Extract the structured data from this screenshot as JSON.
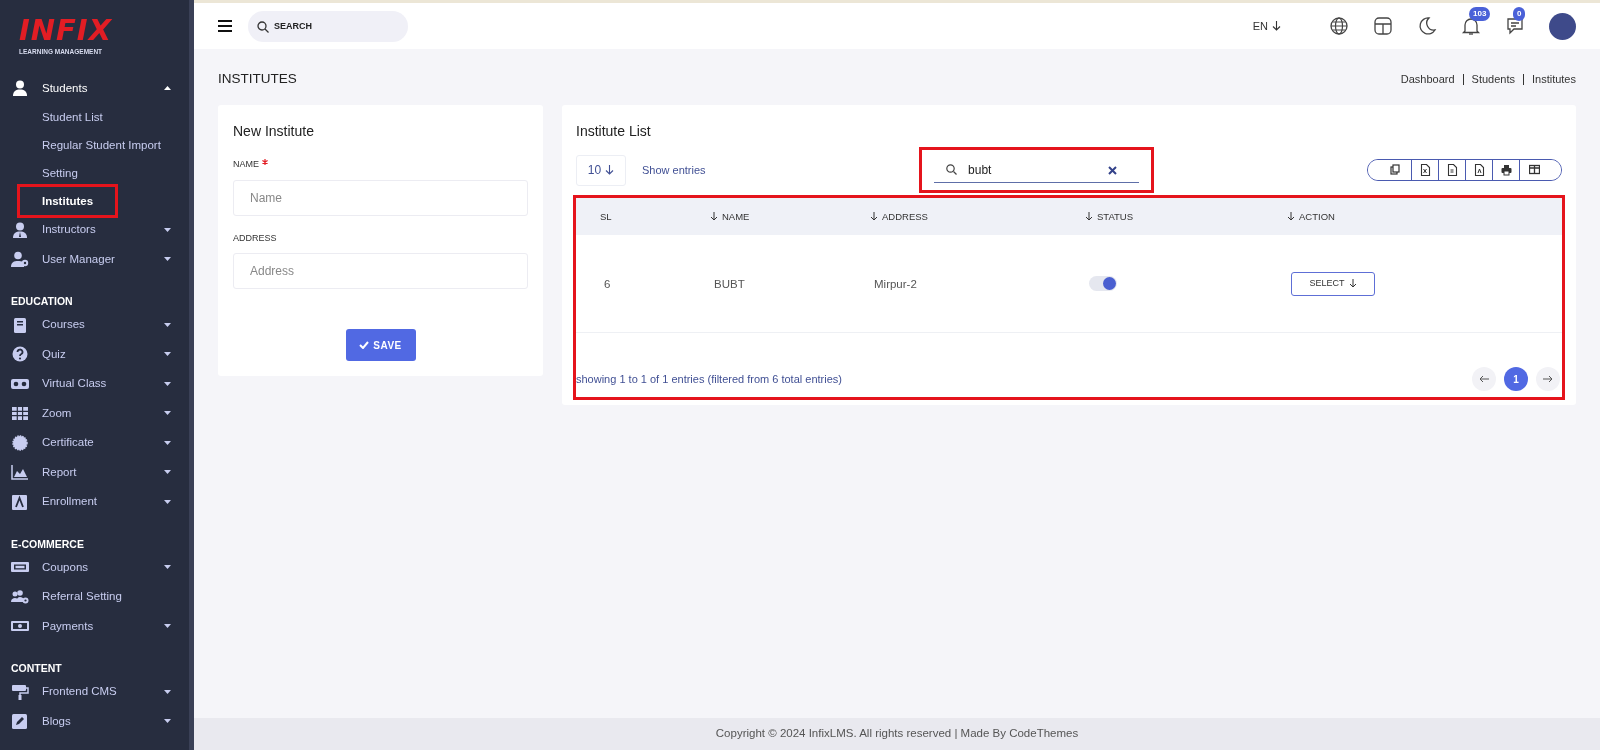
{
  "logo": {
    "title": "INFIX",
    "subtitle": "LEARNING MANAGEMENT"
  },
  "sidebar": {
    "sections": [
      {
        "items": [
          {
            "label": "Students",
            "expandable": true,
            "expanded": true,
            "children": [
              {
                "label": "Student List",
                "selected": false,
                "highlighted": false
              },
              {
                "label": "Regular Student Import",
                "selected": false,
                "highlighted": false
              },
              {
                "label": "Setting",
                "selected": false,
                "highlighted": false
              },
              {
                "label": "Institutes",
                "selected": true,
                "highlighted": true
              }
            ]
          },
          {
            "label": "Instructors",
            "expandable": true,
            "expanded": false
          },
          {
            "label": "User Manager",
            "expandable": true,
            "expanded": false
          }
        ]
      },
      {
        "heading": "EDUCATION",
        "items": [
          {
            "label": "Courses",
            "expandable": true,
            "expanded": false
          },
          {
            "label": "Quiz",
            "expandable": true,
            "expanded": false
          },
          {
            "label": "Virtual Class",
            "expandable": true,
            "expanded": false
          },
          {
            "label": "Zoom",
            "expandable": true,
            "expanded": false
          },
          {
            "label": "Certificate",
            "expandable": true,
            "expanded": false
          },
          {
            "label": "Report",
            "expandable": true,
            "expanded": false
          },
          {
            "label": "Enrollment",
            "expandable": true,
            "expanded": false
          }
        ]
      },
      {
        "heading": "E-COMMERCE",
        "items": [
          {
            "label": "Coupons",
            "expandable": true,
            "expanded": false
          },
          {
            "label": "Referral Setting",
            "expandable": false,
            "expanded": false
          },
          {
            "label": "Payments",
            "expandable": true,
            "expanded": false
          }
        ]
      },
      {
        "heading": "CONTENT",
        "items": [
          {
            "label": "Frontend CMS",
            "expandable": true,
            "expanded": false
          },
          {
            "label": "Blogs",
            "expandable": true,
            "expanded": false
          }
        ]
      }
    ]
  },
  "topbar": {
    "search": {
      "placeholder": "SEARCH"
    },
    "language": "EN",
    "notifications": "103",
    "messages": "0"
  },
  "page": {
    "title": "INSTITUTES",
    "breadcrumb": [
      "Dashboard",
      "Students",
      "Institutes"
    ]
  },
  "form": {
    "title": "New Institute",
    "fields": [
      {
        "label": "NAME",
        "required": true,
        "placeholder": "Name"
      },
      {
        "label": "ADDRESS",
        "placeholder": "Address"
      }
    ],
    "save": "SAVE"
  },
  "list": {
    "title": "Institute List",
    "page_size": "10",
    "show_entries": "Show entries",
    "search": {
      "value": "bubt",
      "highlighted": true
    },
    "highlighted": true,
    "columns": [
      {
        "label": "SL",
        "sortable": false
      },
      {
        "label": "NAME",
        "sortable": true
      },
      {
        "label": "ADDRESS",
        "sortable": true
      },
      {
        "label": "STATUS",
        "sortable": true
      },
      {
        "label": "ACTION",
        "sortable": true
      }
    ],
    "rows": [
      {
        "sl": "6",
        "name": "BUBT",
        "address": "Mirpur-2",
        "status_on": true,
        "action": "SELECT"
      }
    ],
    "info": "showing 1 to 1 of 1 entries (filtered from 6 total entries)",
    "pages": [
      {
        "label": "1",
        "selected": true
      }
    ]
  },
  "footer": "Copyright © 2024 InfixLMS. All rights reserved | Made By CodeThemes"
}
